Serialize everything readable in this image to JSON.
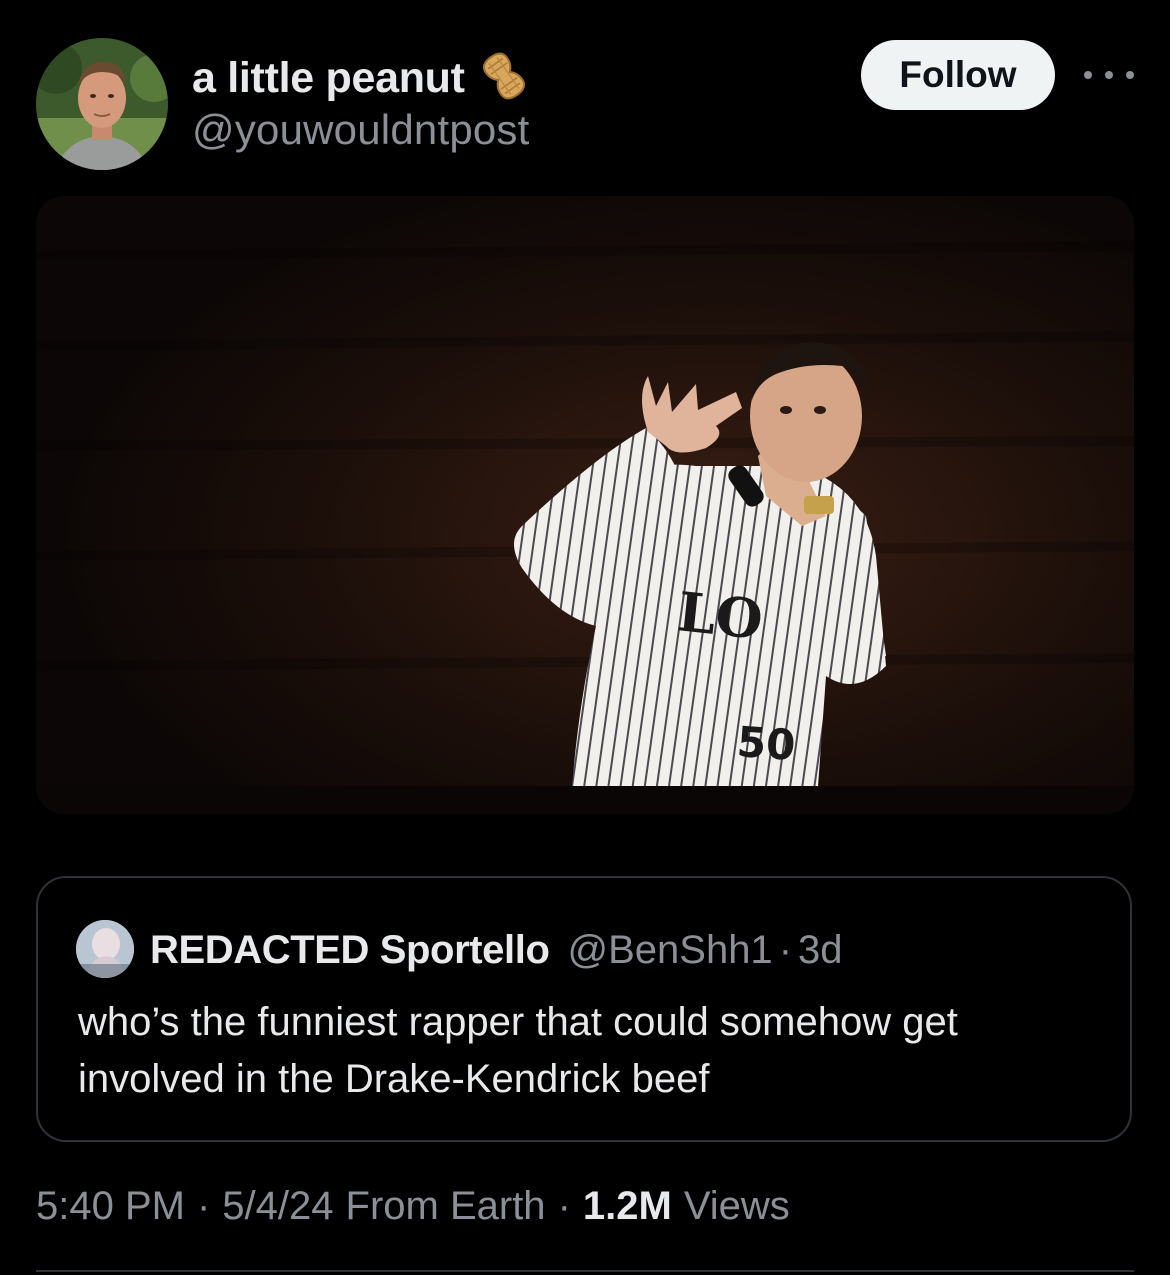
{
  "author": {
    "display_name": "a little peanut",
    "handle": "@youwouldntpost",
    "badge_icon": "peanut-icon"
  },
  "actions": {
    "follow_label": "Follow",
    "more_icon": "more-horizontal-icon"
  },
  "media": {
    "jersey_letters": "LO",
    "jersey_number": "50"
  },
  "quoted_tweet": {
    "display_name": "REDACTED Sportello",
    "handle": "@BenShh1",
    "separator": "·",
    "time_ago": "3d",
    "text": "who’s the funniest rapper that could somehow get involved in the Drake-Kendrick beef"
  },
  "meta": {
    "time": "5:40 PM",
    "date": "5/4/24",
    "source": "From Earth",
    "views_count": "1.2M",
    "views_label": "Views",
    "separator": "·"
  },
  "colors": {
    "background": "#000000",
    "primary_text": "#e7e9ea",
    "secondary_text": "#8b9096",
    "border": "#2f3336",
    "follow_bg": "#eff3f4"
  }
}
